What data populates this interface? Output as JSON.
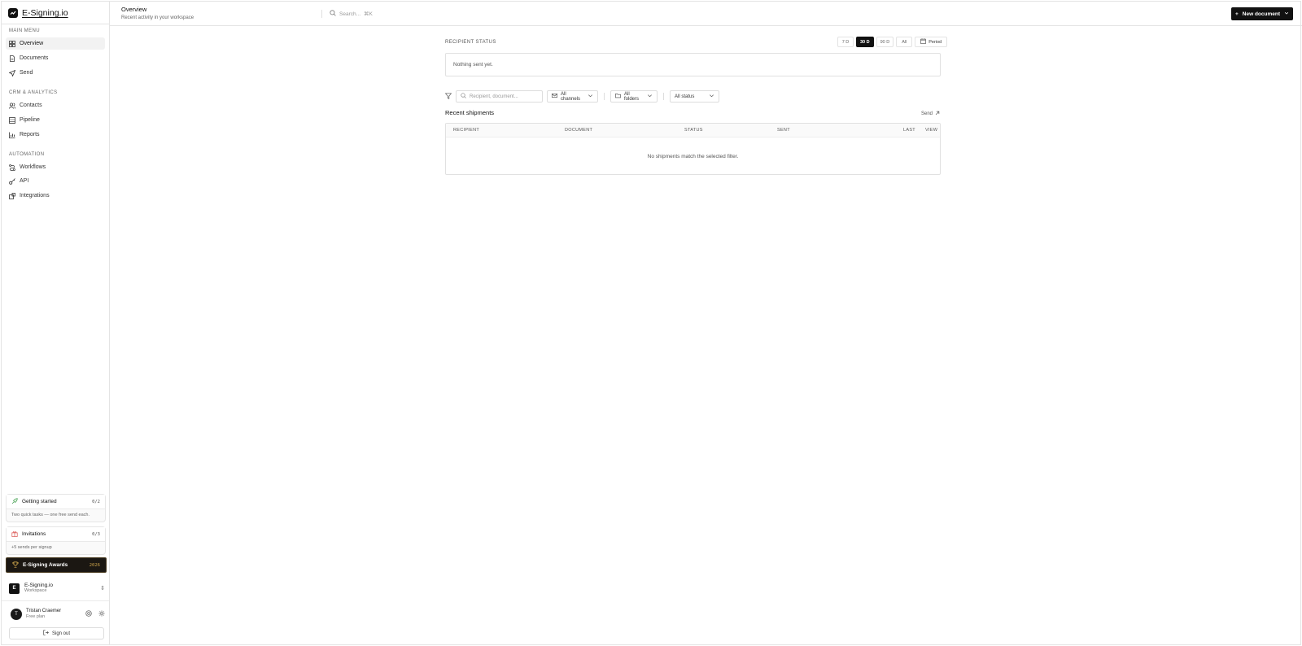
{
  "brand": {
    "name": "E-Signing.io"
  },
  "sidebar": {
    "sections": [
      {
        "title": "MAIN MENU",
        "items": [
          {
            "label": "Overview",
            "icon": "grid-icon",
            "active": true
          },
          {
            "label": "Documents",
            "icon": "document-icon"
          },
          {
            "label": "Send",
            "icon": "send-icon"
          }
        ]
      },
      {
        "title": "CRM & ANALYTICS",
        "items": [
          {
            "label": "Contacts",
            "icon": "users-icon"
          },
          {
            "label": "Pipeline",
            "icon": "pipeline-icon"
          },
          {
            "label": "Reports",
            "icon": "chart-icon"
          }
        ]
      },
      {
        "title": "AUTOMATION",
        "items": [
          {
            "label": "Workflows",
            "icon": "workflow-icon"
          },
          {
            "label": "API",
            "icon": "key-icon"
          },
          {
            "label": "Integrations",
            "icon": "puzzle-icon"
          }
        ]
      }
    ],
    "getting_started": {
      "label": "Getting started",
      "count": "0/2",
      "sub": "Two quick tasks — one free send each."
    },
    "invitations": {
      "label": "Invitations",
      "count": "0/3",
      "sub": "+5 sends per signup"
    },
    "awards": {
      "label": "E-Signing Awards",
      "year": "2026"
    },
    "workspace": {
      "name": "E-Signing.io",
      "sub": "Workspace",
      "initial": "E"
    },
    "user": {
      "name": "Tristan Craemer",
      "plan": "Free plan",
      "initial": "T"
    },
    "signout_label": "Sign out"
  },
  "topbar": {
    "title": "Overview",
    "subtitle": "Recent activity in your workspace",
    "search_placeholder": "Search...",
    "search_shortcut": "⌘K",
    "new_document_label": "New document"
  },
  "recipient_status": {
    "title": "RECIPIENT STATUS",
    "periods": [
      "7 D",
      "30 D",
      "90 D",
      "All"
    ],
    "active_period": "30 D",
    "period_button_label": "Period",
    "empty_text": "Nothing sent yet."
  },
  "filters": {
    "search_placeholder": "Recipient, document...",
    "channels": "All channels",
    "folders": "All folders",
    "status": "All status"
  },
  "shipments": {
    "title": "Recent shipments",
    "send_link": "Send",
    "columns": [
      "RECIPIENT",
      "DOCUMENT",
      "STATUS",
      "SENT",
      "LAST",
      "VIEW"
    ],
    "empty_text": "No shipments match the selected filter."
  },
  "colors": {
    "accent": "#111111",
    "awards_bg": "#1b1712",
    "awards_year": "#c9a14a"
  }
}
